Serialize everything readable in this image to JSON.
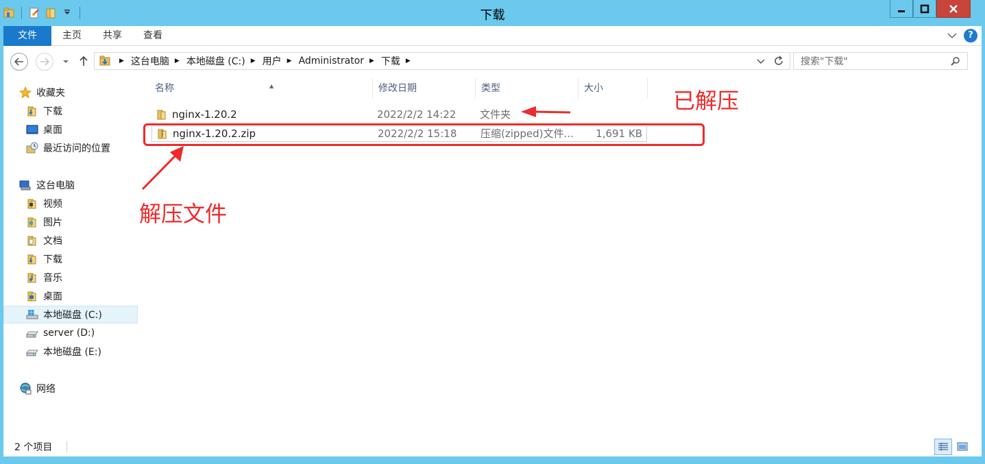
{
  "window": {
    "title": "下载",
    "colors": {
      "frame": "#6ac9ec",
      "file_tab": "#1979ca",
      "close": "#c7453a",
      "annotation": "#ef2a2a"
    }
  },
  "ribbon": {
    "tabs": [
      "文件",
      "主页",
      "共享",
      "查看"
    ],
    "help_label": "?"
  },
  "address": {
    "crumbs": [
      "这台电脑",
      "本地磁盘 (C:)",
      "用户",
      "Administrator",
      "下载"
    ],
    "search_placeholder": "搜索\"下载\""
  },
  "sidebar": {
    "favorites_label": "收藏夹",
    "favorites": [
      {
        "label": "下载",
        "icon": "downloads-folder-icon"
      },
      {
        "label": "桌面",
        "icon": "desktop-icon"
      },
      {
        "label": "最近访问的位置",
        "icon": "recent-places-icon"
      }
    ],
    "computer_label": "这台电脑",
    "computer_items": [
      {
        "label": "视频",
        "icon": "videos-folder-icon"
      },
      {
        "label": "图片",
        "icon": "pictures-folder-icon"
      },
      {
        "label": "文档",
        "icon": "documents-folder-icon"
      },
      {
        "label": "下载",
        "icon": "downloads-folder-icon"
      },
      {
        "label": "音乐",
        "icon": "music-folder-icon"
      },
      {
        "label": "桌面",
        "icon": "desktop-folder-icon"
      },
      {
        "label": "本地磁盘 (C:)",
        "icon": "system-drive-icon",
        "selected": true
      },
      {
        "label": "server (D:)",
        "icon": "drive-icon"
      },
      {
        "label": "本地磁盘 (E:)",
        "icon": "drive-icon"
      }
    ],
    "network_label": "网络"
  },
  "columns": [
    "名称",
    "修改日期",
    "类型",
    "大小"
  ],
  "files": [
    {
      "name": "nginx-1.20.2",
      "modified": "2022/2/2 14:22",
      "type": "文件夹",
      "size": "",
      "icon": "folder-icon"
    },
    {
      "name": "nginx-1.20.2.zip",
      "modified": "2022/2/2 15:18",
      "type": "压缩(zipped)文件...",
      "size": "1,691 KB",
      "icon": "zip-folder-icon"
    }
  ],
  "annotations": {
    "extracted": "已解压",
    "extract_file": "解压文件"
  },
  "status": {
    "count": "2 个项目"
  }
}
